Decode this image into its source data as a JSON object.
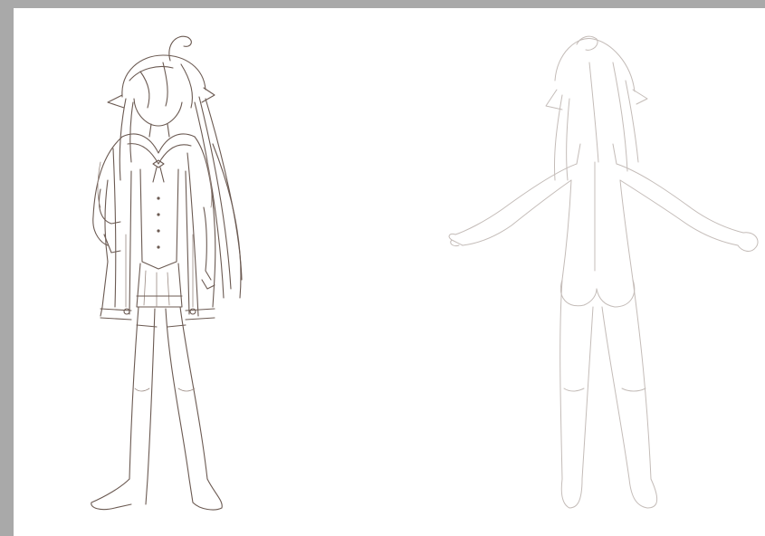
{
  "canvas": {
    "background_color": "#ffffff",
    "workspace_color": "#a9a9a9"
  },
  "figures": [
    {
      "name": "front-view-clothed-sketch",
      "line_color": "#6b5a52"
    },
    {
      "name": "back-view-body-sketch",
      "line_color": "#c4bcb8"
    }
  ]
}
